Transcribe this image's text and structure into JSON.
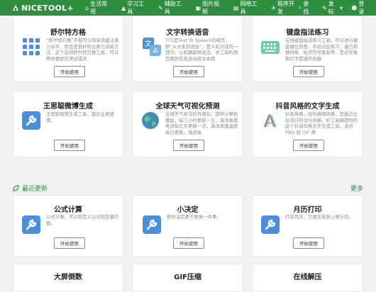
{
  "topbar": {
    "logo": "NICETOOL",
    "logo_plus": "+",
    "nav": [
      {
        "label": "生活常用",
        "icon": "home-icon"
      },
      {
        "label": "学习工具",
        "icon": "graduation-icon"
      },
      {
        "label": "辅助工具",
        "icon": "wrench-icon"
      },
      {
        "label": "图片视频",
        "icon": "image-icon"
      },
      {
        "label": "网络工具",
        "icon": "network-icon"
      },
      {
        "label": "程序开发",
        "icon": "code-icon"
      }
    ],
    "right": [
      {
        "label": "查找",
        "icon": "search-icon"
      },
      {
        "label": "发帖",
        "icon": "post-icon"
      },
      {
        "label": "登录",
        "icon": "user-icon"
      }
    ]
  },
  "cards_top": [
    {
      "title": "舒尔特方格",
      "desc": "“舒尔特方格”不但可以简单测量注意力水平，而且是很好的注意力训练方法。这个在线舒尔特方格工具，可以帮你更好的测试或训",
      "btn": "开始使用",
      "icon": "grid-icon"
    },
    {
      "title": "文字转换语音",
      "desc": "TTS是Text To Speech的缩写，即“从文本到语音”，是人机对话的一部分，让机器能够说话。本工具利用百度的实现自动将文本转",
      "btn": "开始使用",
      "icon": "translate-icon"
    },
    {
      "title": "键盘指法练习",
      "desc": "在线键盘指法练习工具，可以进行键盘键位熟悉，手指分区练习，键位和横排练、标点符号联系等，是初学者和打字提速的利器",
      "btn": "开始使用",
      "icon": "keyboard-icon"
    }
  ],
  "cards_mid": [
    {
      "title": "王思聪微博生成",
      "desc": "王思聪微博生成工具，建议全屏使用。",
      "btn": "开始使用",
      "icon": "wrench-icon"
    },
    {
      "title": "全球天气可视化预测",
      "desc": "全球天气状况的可视化，提供计算机模拟，每三小时更新一次，海洋表面电流每五天更新一次，海洋表面温度每日更新，海浪每",
      "btn": "开始使用",
      "icon": "globe-icon"
    },
    {
      "title": "抖音风格的文字生成",
      "desc": "抖音风格，也叫故障风格，是最近比较流行的设计风格，好工具网提供的这个抖音风格文字生成工具，支持 PNG 和 GIF 两",
      "btn": "开始使用",
      "icon": "letter-a-icon"
    }
  ],
  "recent": {
    "label": "最近更新",
    "more": "更多"
  },
  "cards_bottom": [
    {
      "title": "公式计算",
      "desc": "公式计算。可以自定义公式和变量的值。",
      "btn": "开始使用",
      "icon": "wrench-icon"
    },
    {
      "title": "小决定",
      "desc": "帮你决定要不要做一件事。",
      "btn": "开始使用",
      "icon": "wrench-icon"
    },
    {
      "title": "月历打印",
      "desc": "打印月历，方便在纸张上做计划。",
      "btn": "开始使用",
      "icon": "wrench-icon"
    }
  ],
  "cards_last": [
    {
      "title": "大屏倒数"
    },
    {
      "title": "GIF压缩"
    },
    {
      "title": "在线解压"
    }
  ]
}
